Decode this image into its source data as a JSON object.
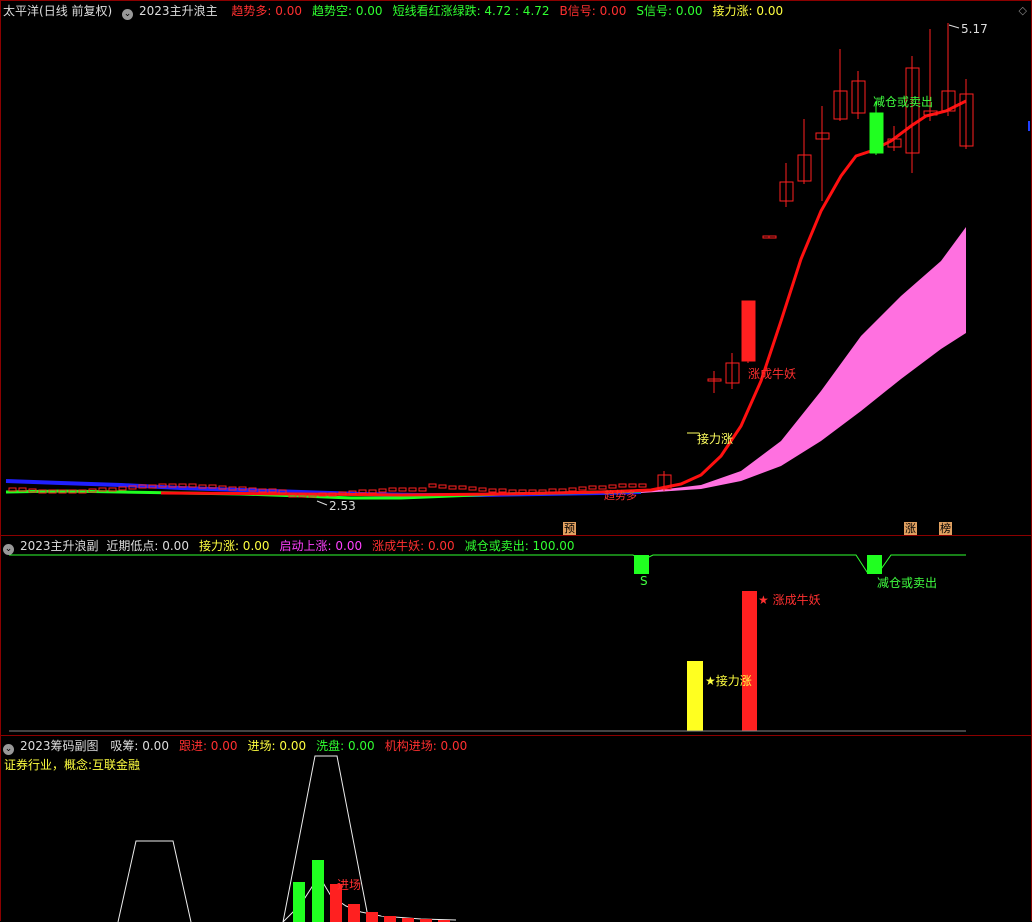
{
  "main": {
    "title": "太平洋",
    "period": "(日线 前复权)",
    "indicator": "2023主升浪主",
    "fields": [
      {
        "label": "趋势多",
        "value": "0.00",
        "color": "#ff3030"
      },
      {
        "label": "趋势空",
        "value": "0.00",
        "color": "#30ff30"
      },
      {
        "label": "短线看红涨绿跌",
        "value": "4.72 : 4.72",
        "color": "#30ff30"
      },
      {
        "label": "B信号",
        "value": "0.00",
        "color": "#ff3030"
      },
      {
        "label": "S信号",
        "value": "0.00",
        "color": "#30ff30"
      },
      {
        "label": "接力涨",
        "value": "0.00",
        "color": "#ffff40"
      }
    ],
    "high_label": "5.17",
    "low_label": "2.53",
    "annot_jian": "减仓或卖出",
    "annot_zhang": "涨成牛妖",
    "annot_jieli": "接力涨",
    "annot_qushi": "趋势多",
    "tag_yu": "预",
    "tag_zhang": "涨",
    "tag_bang": "榜"
  },
  "sub1": {
    "indicator": "2023主升浪副",
    "fields": [
      {
        "label": "近期低点",
        "value": "0.00",
        "color": "#dddddd"
      },
      {
        "label": "接力涨",
        "value": "0.00",
        "color": "#ffff40"
      },
      {
        "label": "启动上涨",
        "value": "0.00",
        "color": "#ff40ff"
      },
      {
        "label": "涨成牛妖",
        "value": "0.00",
        "color": "#ff3030"
      },
      {
        "label": "减仓或卖出",
        "value": "100.00",
        "color": "#30ff30"
      }
    ],
    "s_label": "S",
    "jian_label": "减仓或卖出",
    "zhang_label": "★ 涨成牛妖",
    "jieli_label": "★接力涨"
  },
  "sub2": {
    "indicator": "2023筹码副图",
    "fields": [
      {
        "label": "吸筹",
        "value": "0.00",
        "color": "#dddddd"
      },
      {
        "label": "跟进",
        "value": "0.00",
        "color": "#ff3030"
      },
      {
        "label": "进场",
        "value": "0.00",
        "color": "#ffff40"
      },
      {
        "label": "洗盘",
        "value": "0.00",
        "color": "#30ff30"
      },
      {
        "label": "机构进场",
        "value": "0.00",
        "color": "#ff3030"
      }
    ],
    "industry": "证券行业，概念:互联金融",
    "jinchang_label": "进场"
  },
  "colors": {
    "up": "#ff2020",
    "down": "#20ff20",
    "ma": "#ff1010",
    "band": "#ff70e0",
    "blue": "#2020ff"
  }
}
